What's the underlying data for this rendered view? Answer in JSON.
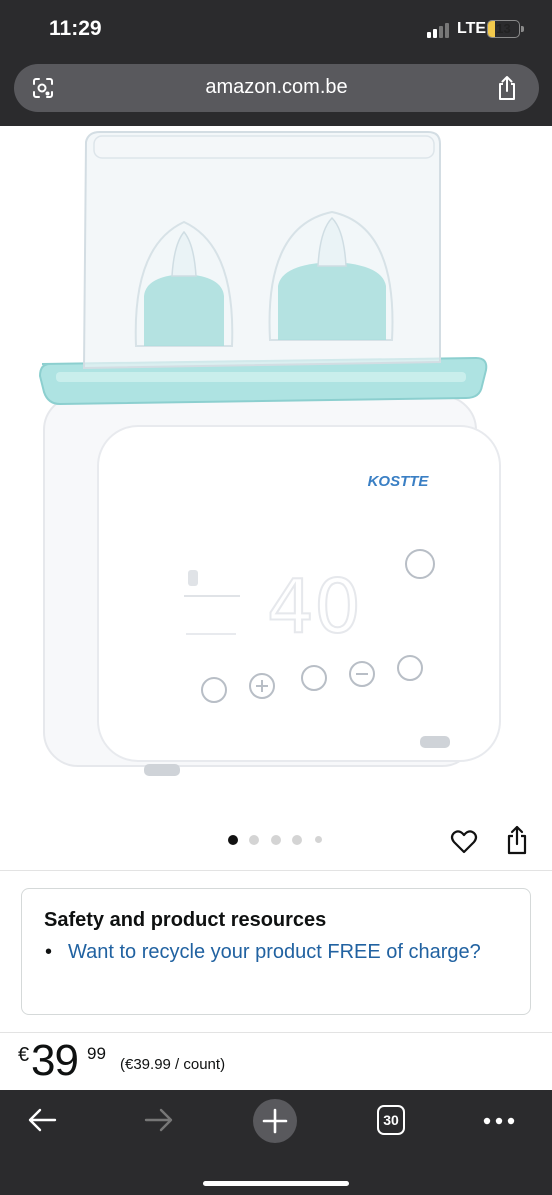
{
  "status_bar": {
    "time": "11:29",
    "network": "LTE",
    "battery": "13"
  },
  "browser": {
    "url": "amazon.com.be"
  },
  "product": {
    "brand_on_image": "KOSTTE",
    "display_reading": "40",
    "image_dots": 5,
    "active_dot": 0
  },
  "safety": {
    "title": "Safety and product resources",
    "bullet": "•",
    "link_text": "Want to recycle your product FREE of charge?"
  },
  "price": {
    "currency": "€",
    "whole": "39",
    "fraction": "99",
    "unit_price": "(€39.99 / count)"
  },
  "toolbar": {
    "tabs_count": "30"
  },
  "colors": {
    "chrome_dark": "#2b2b2d",
    "url_pill": "#59595d",
    "link_blue": "#2162a1",
    "battery_yellow": "#f2c94c",
    "product_teal": "#aee3e2"
  }
}
